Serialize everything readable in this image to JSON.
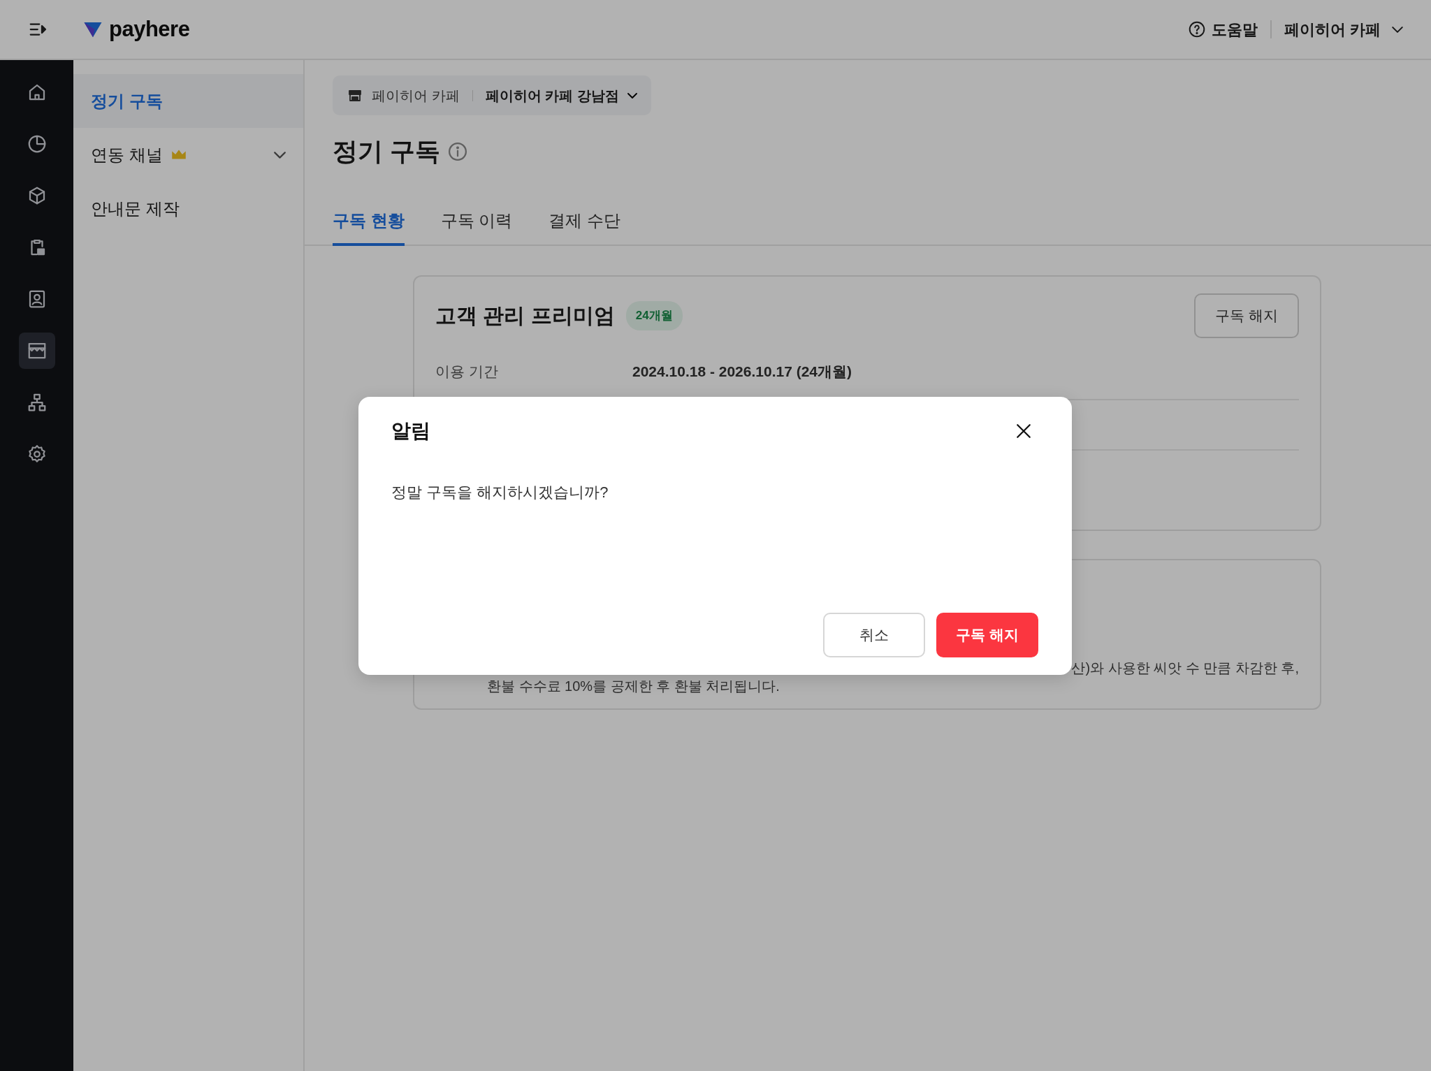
{
  "header": {
    "logo": "payhere",
    "help": "도움말",
    "account": "페이히어 카페"
  },
  "rail": {
    "items": [
      {
        "kind": "home",
        "selected": false
      },
      {
        "kind": "chart",
        "selected": false
      },
      {
        "kind": "cube",
        "selected": false
      },
      {
        "kind": "clipboard",
        "selected": false
      },
      {
        "kind": "contact",
        "selected": false
      },
      {
        "kind": "store",
        "selected": true
      },
      {
        "kind": "hierarchy",
        "selected": false
      },
      {
        "kind": "gear",
        "selected": false
      }
    ]
  },
  "sidebar": {
    "items": [
      {
        "label": "정기 구독",
        "selected": true,
        "premium": false,
        "expandable": false
      },
      {
        "label": "연동 채널",
        "selected": false,
        "premium": true,
        "expandable": true
      },
      {
        "label": "안내문 제작",
        "selected": false,
        "premium": false,
        "expandable": false
      }
    ]
  },
  "store_selector": {
    "brand": "페이히어 카페",
    "branch": "페이히어 카페 강남점"
  },
  "page_title": "정기 구독",
  "tabs": [
    {
      "label": "구독 현황",
      "selected": true
    },
    {
      "label": "구독 이력",
      "selected": false
    },
    {
      "label": "결제 수단",
      "selected": false
    }
  ],
  "subscription_card": {
    "title": "고객 관리 프리미엄",
    "badge": "24개월",
    "button": "구독 해지",
    "rows": [
      {
        "label": "이용 기간",
        "value": "2024.10.18 - 2026.10.17 (24개월)"
      }
    ]
  },
  "notice_card": {
    "lines": [
      "산)와 사용한 씨앗 수 만큼 차감한 후,",
      "환불 수수료 10%를 공제한 후 환불 처리됩니다."
    ]
  },
  "dialog": {
    "title": "알림",
    "message": "정말 구독을 해지하시겠습니까?",
    "buttons": [
      {
        "label": "취소",
        "kind": "secondary"
      },
      {
        "label": "구독 해지",
        "kind": "danger"
      }
    ]
  }
}
